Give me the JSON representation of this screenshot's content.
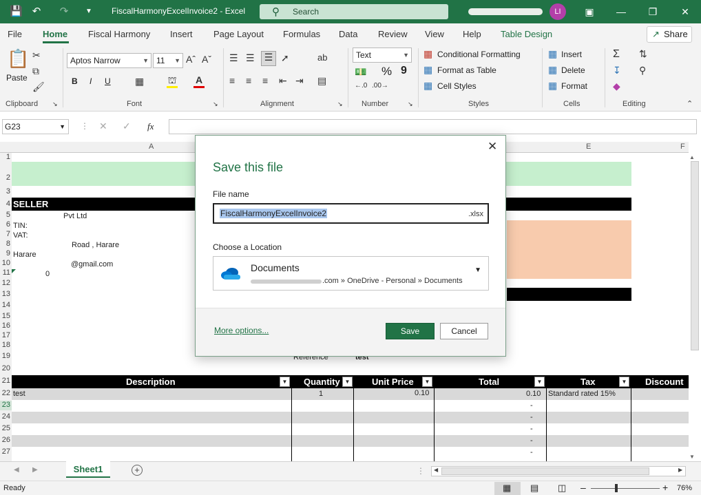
{
  "window": {
    "title": "FiscalHarmonyExcelInvoice2  -  Excel",
    "search_placeholder": "Search",
    "user_initials": "LI"
  },
  "tabs": [
    "File",
    "Home",
    "Fiscal Harmony",
    "Insert",
    "Page Layout",
    "Formulas",
    "Data",
    "Review",
    "View",
    "Help",
    "Table Design"
  ],
  "share_label": "Share",
  "ribbon": {
    "clipboard": {
      "paste": "Paste",
      "label": "Clipboard"
    },
    "font": {
      "name": "Aptos Narrow",
      "size": "11",
      "label": "Font",
      "bold": "B",
      "italic": "I",
      "underline": "U"
    },
    "alignment": {
      "label": "Alignment"
    },
    "number": {
      "format": "Text",
      "label": "Number",
      "percent": "%",
      "comma": "9"
    },
    "styles": {
      "conditional": "Conditional Formatting",
      "format_table": "Format as Table",
      "cell_styles": "Cell Styles",
      "label": "Styles"
    },
    "cells": {
      "insert": "Insert",
      "delete": "Delete",
      "format": "Format",
      "label": "Cells"
    },
    "editing": {
      "label": "Editing"
    }
  },
  "formula_bar": {
    "name_box": "G23",
    "fx": "fx"
  },
  "columns": [
    "A",
    "E",
    "F"
  ],
  "rows": [
    "1",
    "2",
    "3",
    "4",
    "5",
    "6",
    "7",
    "8",
    "9",
    "10",
    "11",
    "12",
    "13",
    "14",
    "15",
    "16",
    "17",
    "18",
    "19",
    "20",
    "21",
    "22",
    "23",
    "24",
    "25",
    "26",
    "27"
  ],
  "sheet_cells": {
    "seller": "SELLER",
    "company": "Pvt Ltd",
    "tin": "TIN:",
    "vat": "VAT:",
    "address": "Road , Harare",
    "city": "Harare",
    "email": "@gmail.com",
    "phone": "0",
    "reference_label": "Reference",
    "reference_value": "test"
  },
  "table": {
    "headers": [
      "Description",
      "Quantity",
      "Unit Price",
      "Total",
      "Tax",
      "Discount"
    ],
    "rows": [
      {
        "description": "test",
        "quantity": "1",
        "unit_price": "0.10",
        "total": "0.10",
        "tax": "Standard rated 15%"
      },
      {
        "total": "-"
      },
      {
        "total": "-"
      },
      {
        "total": "-"
      },
      {
        "total": "-"
      },
      {
        "total": "-"
      }
    ]
  },
  "sheet_tab": "Sheet1",
  "status": {
    "ready": "Ready",
    "zoom": "76%"
  },
  "dialog": {
    "title": "Save this file",
    "file_name_label": "File name",
    "file_name_value": "FiscalHarmonyExcelInvoice2",
    "extension": ".xlsx",
    "location_label": "Choose a Location",
    "location_name": "Documents",
    "location_path": ".com » OneDrive - Personal » Documents",
    "more_options": "More options...",
    "save": "Save",
    "cancel": "Cancel"
  },
  "colors": {
    "accent": "#217346",
    "green_fill": "#c6efce",
    "peach_fill": "#f8cbad",
    "selection": "#a9c7ee"
  }
}
